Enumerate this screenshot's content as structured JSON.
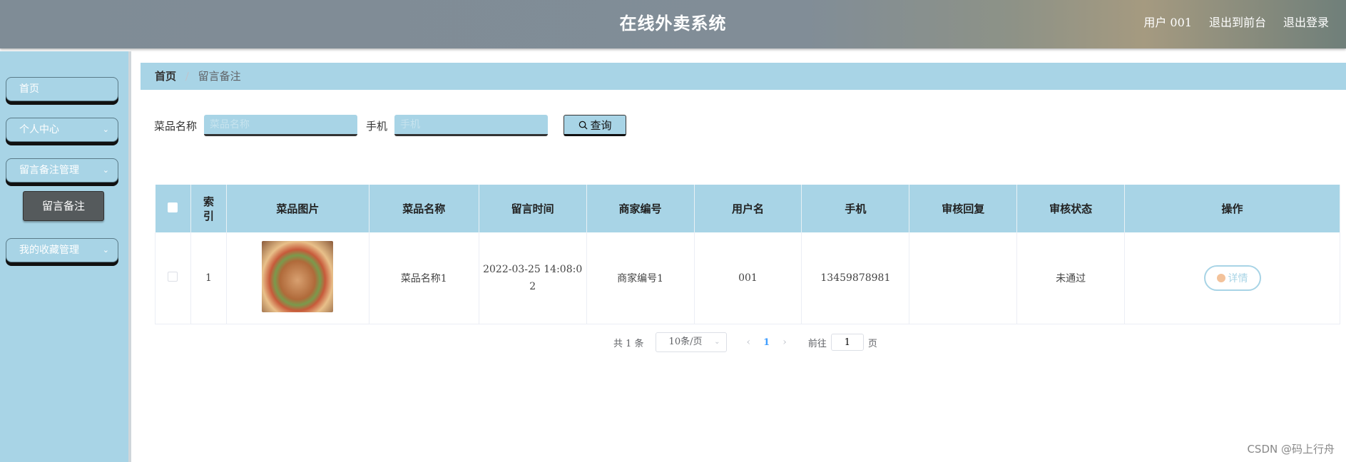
{
  "header": {
    "title": "在线外卖系统",
    "user_label": "用户 001",
    "front_link": "退出到前台",
    "logout_link": "退出登录"
  },
  "sidebar": {
    "items": [
      {
        "label": "首页"
      },
      {
        "label": "个人中心"
      },
      {
        "label": "留言备注管理"
      },
      {
        "label": "我的收藏管理"
      }
    ],
    "active_sub": "留言备注"
  },
  "breadcrumb": {
    "home": "首页",
    "current": "留言备注"
  },
  "search": {
    "dish_label": "菜品名称",
    "dish_placeholder": "菜品名称",
    "phone_label": "手机",
    "phone_placeholder": "手机",
    "query_label": "查询"
  },
  "table": {
    "columns": [
      "索引",
      "菜品图片",
      "菜品名称",
      "留言时间",
      "商家编号",
      "用户名",
      "手机",
      "审核回复",
      "审核状态",
      "操作"
    ],
    "index_header_lines": [
      "索",
      "引"
    ],
    "rows": [
      {
        "index": "1",
        "dish_name": "菜品名称1",
        "time_line1": "2022-03-25 14:08:0",
        "time_line2": "2",
        "merchant_no": "商家编号1",
        "username": "001",
        "phone": "13459878981",
        "reply": "",
        "status": "未通过",
        "action": "详情"
      }
    ]
  },
  "pagination": {
    "total_text": "共 1 条",
    "page_size": "10条/页",
    "current_page": "1",
    "goto_label": "前往",
    "goto_value": "1",
    "page_suffix": "页"
  },
  "watermark": "CSDN @码上行舟"
}
